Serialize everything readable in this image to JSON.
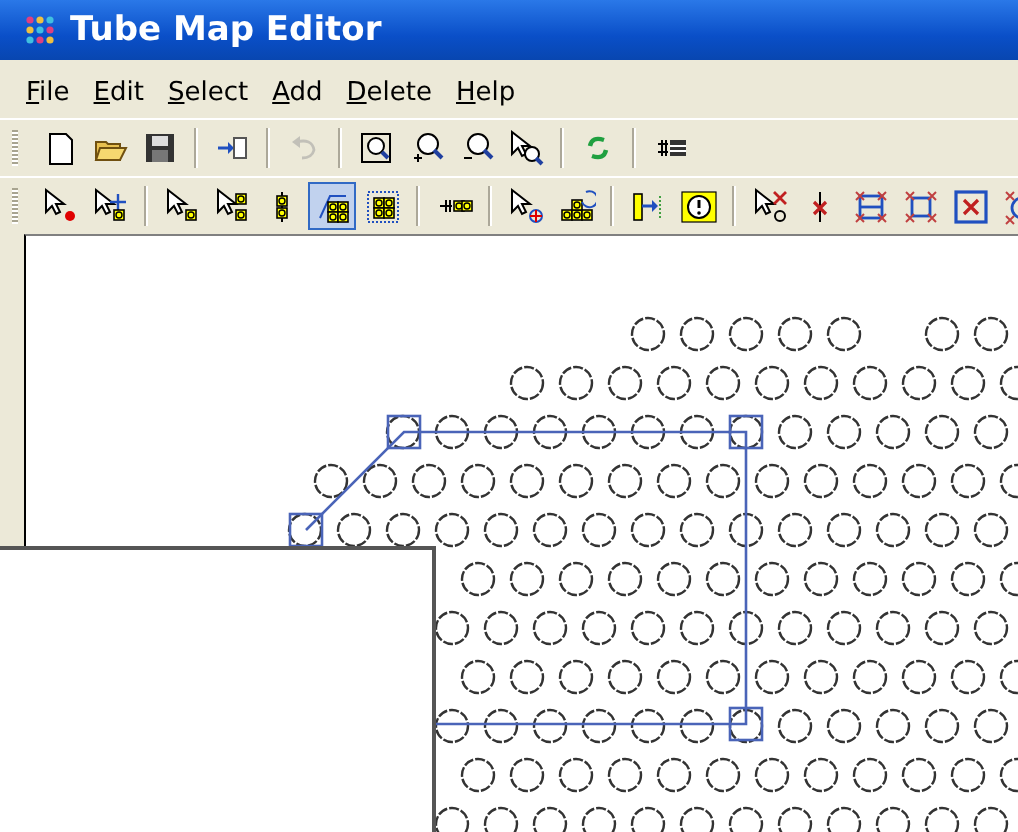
{
  "window": {
    "title": "Tube Map Editor"
  },
  "menu": [
    "File",
    "Edit",
    "Select",
    "Add",
    "Delete",
    "Help"
  ],
  "toolbars": [
    {
      "buttons": [
        {
          "kind": "button",
          "pressed": false,
          "disabled": false
        },
        {
          "kind": "button",
          "pressed": false,
          "disabled": false
        },
        {
          "kind": "button",
          "pressed": false,
          "disabled": false
        },
        {
          "kind": "separator"
        },
        {
          "kind": "button",
          "pressed": false,
          "disabled": false
        },
        {
          "kind": "separator"
        },
        {
          "kind": "button",
          "pressed": false,
          "disabled": true
        },
        {
          "kind": "separator"
        },
        {
          "kind": "button",
          "pressed": false,
          "disabled": false
        },
        {
          "kind": "button",
          "pressed": false,
          "disabled": false
        },
        {
          "kind": "button",
          "pressed": false,
          "disabled": false
        },
        {
          "kind": "button",
          "pressed": false,
          "disabled": false
        },
        {
          "kind": "separator"
        },
        {
          "kind": "button",
          "pressed": false,
          "disabled": false
        },
        {
          "kind": "separator"
        },
        {
          "kind": "button",
          "pressed": false,
          "disabled": false
        }
      ]
    },
    {
      "buttons": [
        {
          "kind": "button",
          "pressed": false,
          "disabled": false
        },
        {
          "kind": "button",
          "pressed": false,
          "disabled": false
        },
        {
          "kind": "separator"
        },
        {
          "kind": "button",
          "pressed": false,
          "disabled": false
        },
        {
          "kind": "button",
          "pressed": false,
          "disabled": false
        },
        {
          "kind": "button",
          "pressed": false,
          "disabled": false
        },
        {
          "kind": "button",
          "pressed": true,
          "disabled": false
        },
        {
          "kind": "button",
          "pressed": false,
          "disabled": false
        },
        {
          "kind": "separator"
        },
        {
          "kind": "button",
          "pressed": false,
          "disabled": false
        },
        {
          "kind": "separator"
        },
        {
          "kind": "button",
          "pressed": false,
          "disabled": false
        },
        {
          "kind": "button",
          "pressed": false,
          "disabled": false
        },
        {
          "kind": "separator"
        },
        {
          "kind": "button",
          "pressed": false,
          "disabled": false
        },
        {
          "kind": "button",
          "pressed": false,
          "disabled": false
        },
        {
          "kind": "separator"
        },
        {
          "kind": "button",
          "pressed": false,
          "disabled": false
        },
        {
          "kind": "button",
          "pressed": false,
          "disabled": false
        },
        {
          "kind": "button",
          "pressed": false,
          "disabled": false
        },
        {
          "kind": "button",
          "pressed": false,
          "disabled": false
        },
        {
          "kind": "button",
          "pressed": false,
          "disabled": false
        },
        {
          "kind": "button",
          "pressed": false,
          "disabled": false
        }
      ]
    }
  ]
}
